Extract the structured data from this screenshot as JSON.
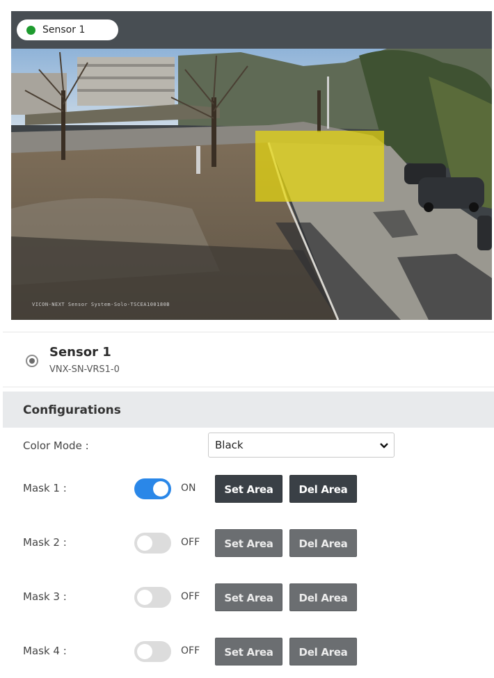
{
  "camera": {
    "sensor_label": "Sensor 1",
    "status_color": "#1e9b2f",
    "watermark": "VICON-NEXT Sensor System-Solo-TSCEA100180B",
    "mask_overlay_color": "#e8d80f"
  },
  "sensor": {
    "name": "Sensor 1",
    "id": "VNX-SN-VRS1-0",
    "selected": true
  },
  "configurations": {
    "title": "Configurations",
    "color_mode": {
      "label": "Color Mode :",
      "value": "Black"
    },
    "masks": [
      {
        "label": "Mask 1 :",
        "state": "ON",
        "enabled": true,
        "set_label": "Set Area",
        "del_label": "Del Area"
      },
      {
        "label": "Mask 2 :",
        "state": "OFF",
        "enabled": false,
        "set_label": "Set Area",
        "del_label": "Del Area"
      },
      {
        "label": "Mask 3 :",
        "state": "OFF",
        "enabled": false,
        "set_label": "Set Area",
        "del_label": "Del Area"
      },
      {
        "label": "Mask 4 :",
        "state": "OFF",
        "enabled": false,
        "set_label": "Set Area",
        "del_label": "Del Area"
      }
    ]
  }
}
